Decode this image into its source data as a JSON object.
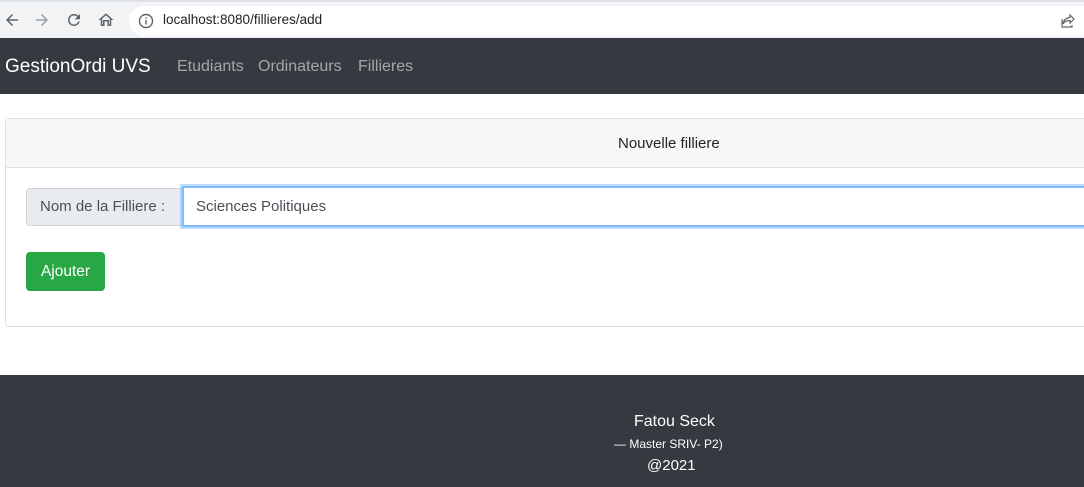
{
  "browser": {
    "url": "localhost:8080/fillieres/add"
  },
  "navbar": {
    "brand": "GestionOrdi UVS",
    "links": [
      "Etudiants",
      "Ordinateurs",
      "Fillieres"
    ]
  },
  "form": {
    "title": "Nouvelle filliere",
    "field_label": "Nom de la Filliere :",
    "field_value": "Sciences Politiques",
    "submit_label": "Ajouter"
  },
  "footer": {
    "name": "Fatou Seck",
    "role": "— Master SRIV- P2)",
    "year": "@2021"
  },
  "colors": {
    "navbar_bg": "#343a40",
    "button_green": "#28a745",
    "input_focus_border": "#80bdff"
  }
}
